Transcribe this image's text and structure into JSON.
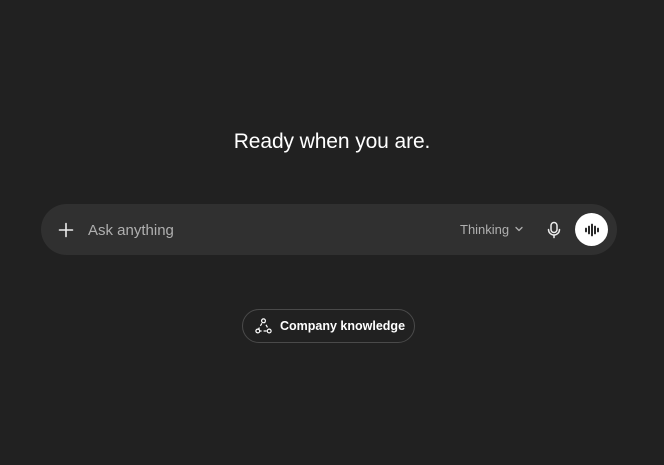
{
  "main": {
    "heading": "Ready when you are."
  },
  "composer": {
    "placeholder": "Ask anything",
    "value": "",
    "plus_icon": "plus-icon",
    "model_label": "Thinking",
    "model_chevron_icon": "chevron-down-icon",
    "mic_icon": "microphone-icon",
    "voice_icon": "voice-waveform-icon"
  },
  "suggestion": {
    "label": "Company knowledge",
    "icon": "connectors-icon"
  },
  "colors": {
    "background": "#212121",
    "composer": "#303030",
    "text": "#ffffff",
    "muted": "#afafaf"
  }
}
